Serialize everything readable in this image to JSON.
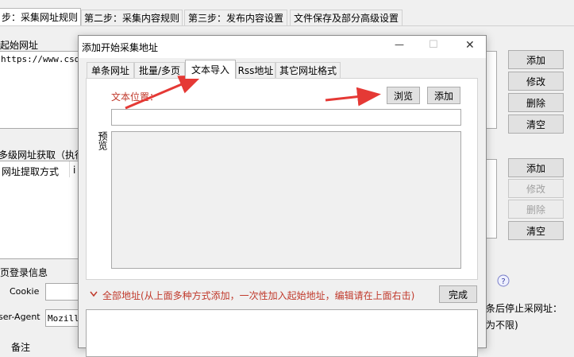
{
  "main": {
    "tabs": [
      {
        "label": "步：采集网址规则",
        "active": true
      },
      {
        "label": "第二步：采集内容规则",
        "active": false
      },
      {
        "label": "第三步：发布内容设置",
        "active": false
      },
      {
        "label": "文件保存及部分高级设置",
        "active": false
      }
    ],
    "start_url_label": "起始网址",
    "start_url_value": "https://www.csdn",
    "right_buttons_top": [
      "添加",
      "修改",
      "删除",
      "清空"
    ],
    "multi_level_label": "多级网址获取（执行",
    "url_extract_header": "网址提取方式",
    "url_extract_header2": "i",
    "right_buttons_mid": [
      {
        "label": "添加",
        "disabled": false
      },
      {
        "label": "修改",
        "disabled": true
      },
      {
        "label": "删除",
        "disabled": true
      },
      {
        "label": "清空",
        "disabled": false
      }
    ],
    "login_label": "页登录信息",
    "cookie_label": "Cookie",
    "user_agent_label": "ser-Agent",
    "user_agent_value": "Mozill",
    "bottom_label": "备注",
    "stop_text_line1": "条后停止采网址：",
    "stop_text_line2": "为不限)",
    "help_icon": "question-icon"
  },
  "dialog": {
    "title": "添加开始采集地址",
    "window_controls": {
      "minimize": "—",
      "maximize": "☐",
      "close": "✕"
    },
    "tabs": [
      {
        "label": "单条网址",
        "active": false
      },
      {
        "label": "批量/多页",
        "active": false
      },
      {
        "label": "文本导入",
        "active": true
      },
      {
        "label": "Rss地址",
        "active": false
      },
      {
        "label": "其它网址格式",
        "active": false
      }
    ],
    "file_location_label": "文本位置：",
    "browse_button": "浏览",
    "add_button": "添加",
    "file_path_value": "",
    "preview_label": "预览",
    "all_addresses_label": "全部地址(从上面多种方式添加，一次性加入起始地址，编辑请在上面右击)",
    "chevron_icon": "chevron-down-icon",
    "done_button": "完成",
    "colors": {
      "annotation_red": "#e53935",
      "label_red": "#c0392b"
    }
  }
}
